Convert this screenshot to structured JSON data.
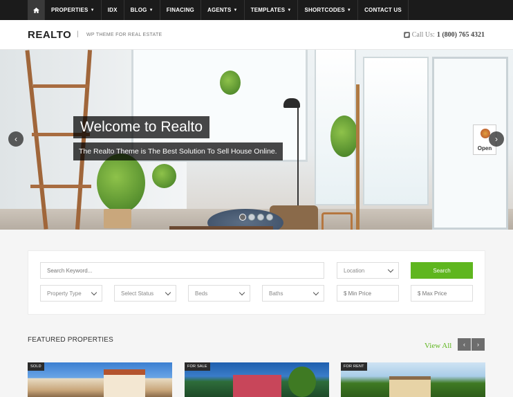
{
  "nav": {
    "items": [
      {
        "label": "PROPERTIES",
        "caret": true
      },
      {
        "label": "IDX",
        "caret": false
      },
      {
        "label": "BLOG",
        "caret": true
      },
      {
        "label": "FINACING",
        "caret": false
      },
      {
        "label": "AGENTS",
        "caret": true
      },
      {
        "label": "TEMPLATES",
        "caret": true
      },
      {
        "label": "SHORTCODES",
        "caret": true
      },
      {
        "label": "CONTACT US",
        "caret": false
      }
    ]
  },
  "header": {
    "logo": "REALTO",
    "separator": "|",
    "tagline": "WP THEME FOR REAL ESTATE",
    "phone_label": "Call Us:",
    "phone_number": "1 (800) 765 4321"
  },
  "hero": {
    "title": "Welcome to Realto",
    "subtitle": "The Realto Theme is The Best Solution To Sell House Online.",
    "sign_text": "Open",
    "slide_count": 4,
    "active_slide": 1
  },
  "search": {
    "keyword_placeholder": "Search Keyword...",
    "location": "Location",
    "button": "Search",
    "property_type": "Property Type",
    "status": "Select Status",
    "beds": "Beds",
    "baths": "Baths",
    "min_price_placeholder": "$ Min Price",
    "max_price_placeholder": "$ Max Price"
  },
  "featured": {
    "title": "FEATURED PROPERTIES",
    "view_all": "View All",
    "cards": [
      {
        "badge": "SOLD"
      },
      {
        "badge": "FOR SALE"
      },
      {
        "badge": "FOR RENT"
      }
    ]
  },
  "colors": {
    "accent": "#5fb61f",
    "nav_bg": "#1b1b1b"
  }
}
